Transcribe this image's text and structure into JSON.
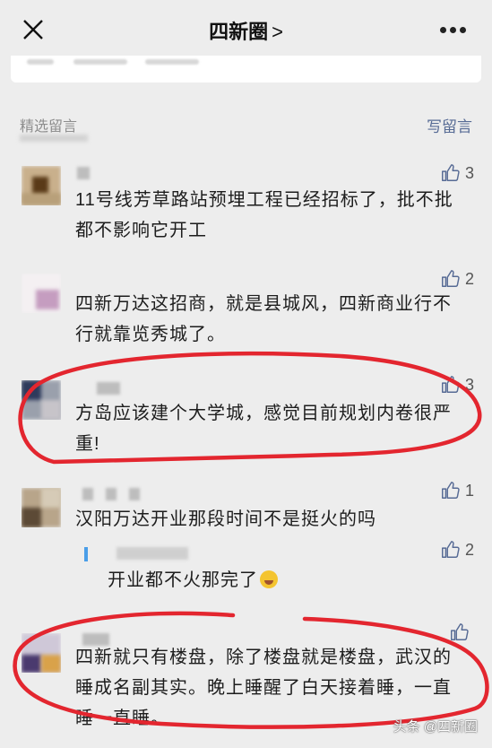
{
  "header": {
    "title": "四新圈",
    "chevron": ">"
  },
  "section": {
    "label": "精选留言",
    "write": "写留言"
  },
  "comments": [
    {
      "text": "11号线芳草路站预埋工程已经招标了，批不批都不影响它开工",
      "likes": "3"
    },
    {
      "text": "四新万达这招商，就是县城风，四新商业行不行就靠览秀城了。",
      "likes": "2"
    },
    {
      "text": "方岛应该建个大学城，感觉目前规划内卷很严重!",
      "likes": "3"
    },
    {
      "text": "汉阳万达开业那段时间不是挺火的吗",
      "likes": "1"
    },
    {
      "text": "四新就只有楼盘，除了楼盘就是楼盘，武汉的睡成名副其实。晚上睡醒了白天接着睡，一直睡一直睡。",
      "likes": ""
    }
  ],
  "reply": {
    "text": "开业都不火那完了",
    "likes": "2"
  },
  "watermark": "头条 @四新圈",
  "colors": {
    "link": "#576b95",
    "highlight": "#e3262f",
    "reply_bar": "#4a9ee8"
  }
}
